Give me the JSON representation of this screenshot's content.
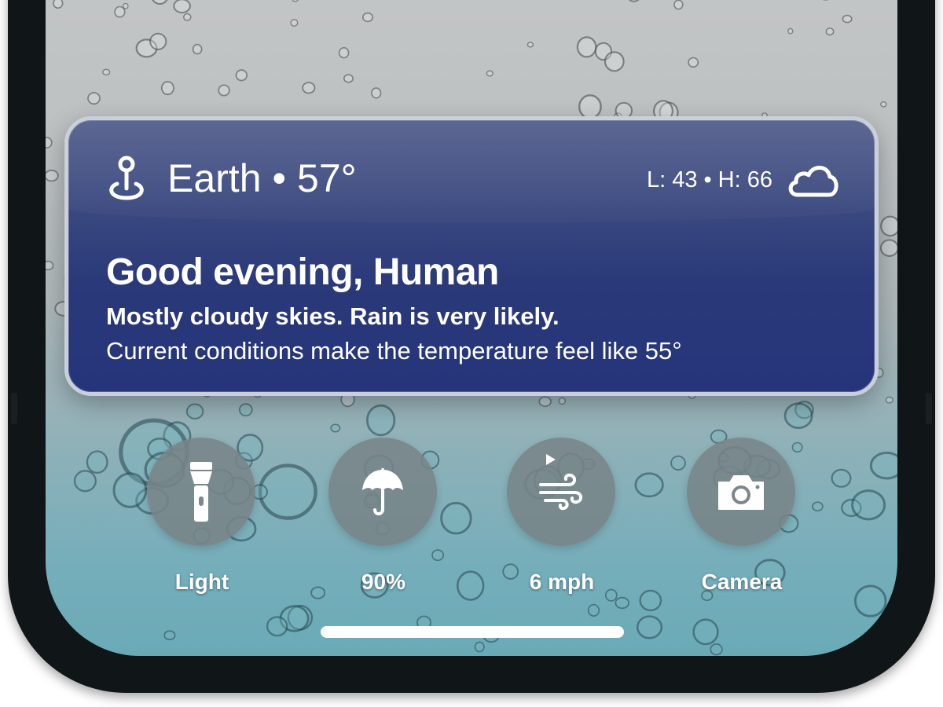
{
  "weather": {
    "location": "Earth",
    "separator": "•",
    "temperature": "57°",
    "low": "L: 43",
    "high": "H: 66",
    "hl_separator": "•",
    "greeting": "Good evening, Human",
    "summary": "Mostly cloudy skies. Rain is very likely.",
    "feels_like": "Current conditions make the temperature feel like 55°",
    "card_color": "#2a3979",
    "location_icon": "location-pin-icon",
    "condition_icon": "cloud-icon"
  },
  "quick_actions": [
    {
      "label": "Light",
      "icon": "flashlight-icon"
    },
    {
      "label": "90%",
      "icon": "umbrella-icon"
    },
    {
      "label": "6 mph",
      "icon": "wind-icon"
    },
    {
      "label": "Camera",
      "icon": "camera-icon"
    }
  ],
  "background": {
    "wallpaper": "rain-drops",
    "top_color": "#c6c8c8",
    "bottom_color": "#6aaab7"
  }
}
